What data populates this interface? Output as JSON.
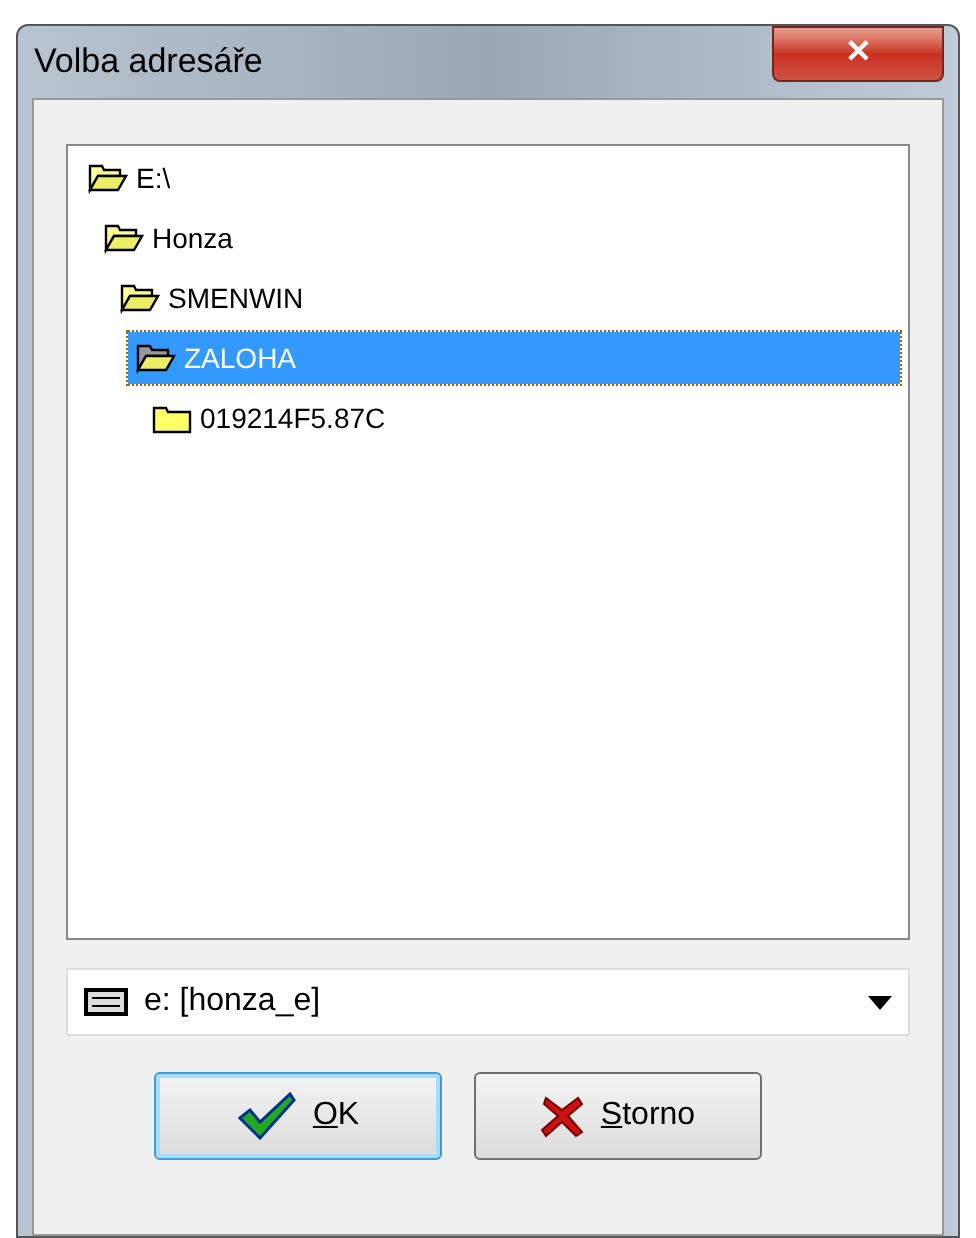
{
  "window": {
    "title": "Volba adresáře",
    "close": "✕"
  },
  "tree": [
    {
      "label": "E:\\",
      "expanded": true,
      "selected": false,
      "children": [
        {
          "label": "Honza",
          "expanded": true,
          "selected": false,
          "children": [
            {
              "label": "SMENWIN",
              "expanded": true,
              "selected": false,
              "children": [
                {
                  "label": "ZALOHA",
                  "expanded": true,
                  "selected": true,
                  "children": [
                    {
                      "label": "019214F5.87C",
                      "expanded": false,
                      "selected": false
                    }
                  ]
                }
              ]
            }
          ]
        }
      ]
    }
  ],
  "drive_select": {
    "value": "e: [honza_e]"
  },
  "buttons": [
    {
      "label": "OK",
      "kind": "ok",
      "underline_first": true,
      "default": true
    },
    {
      "label": "Storno",
      "kind": "cancel",
      "underline_first": true,
      "default": false
    }
  ]
}
